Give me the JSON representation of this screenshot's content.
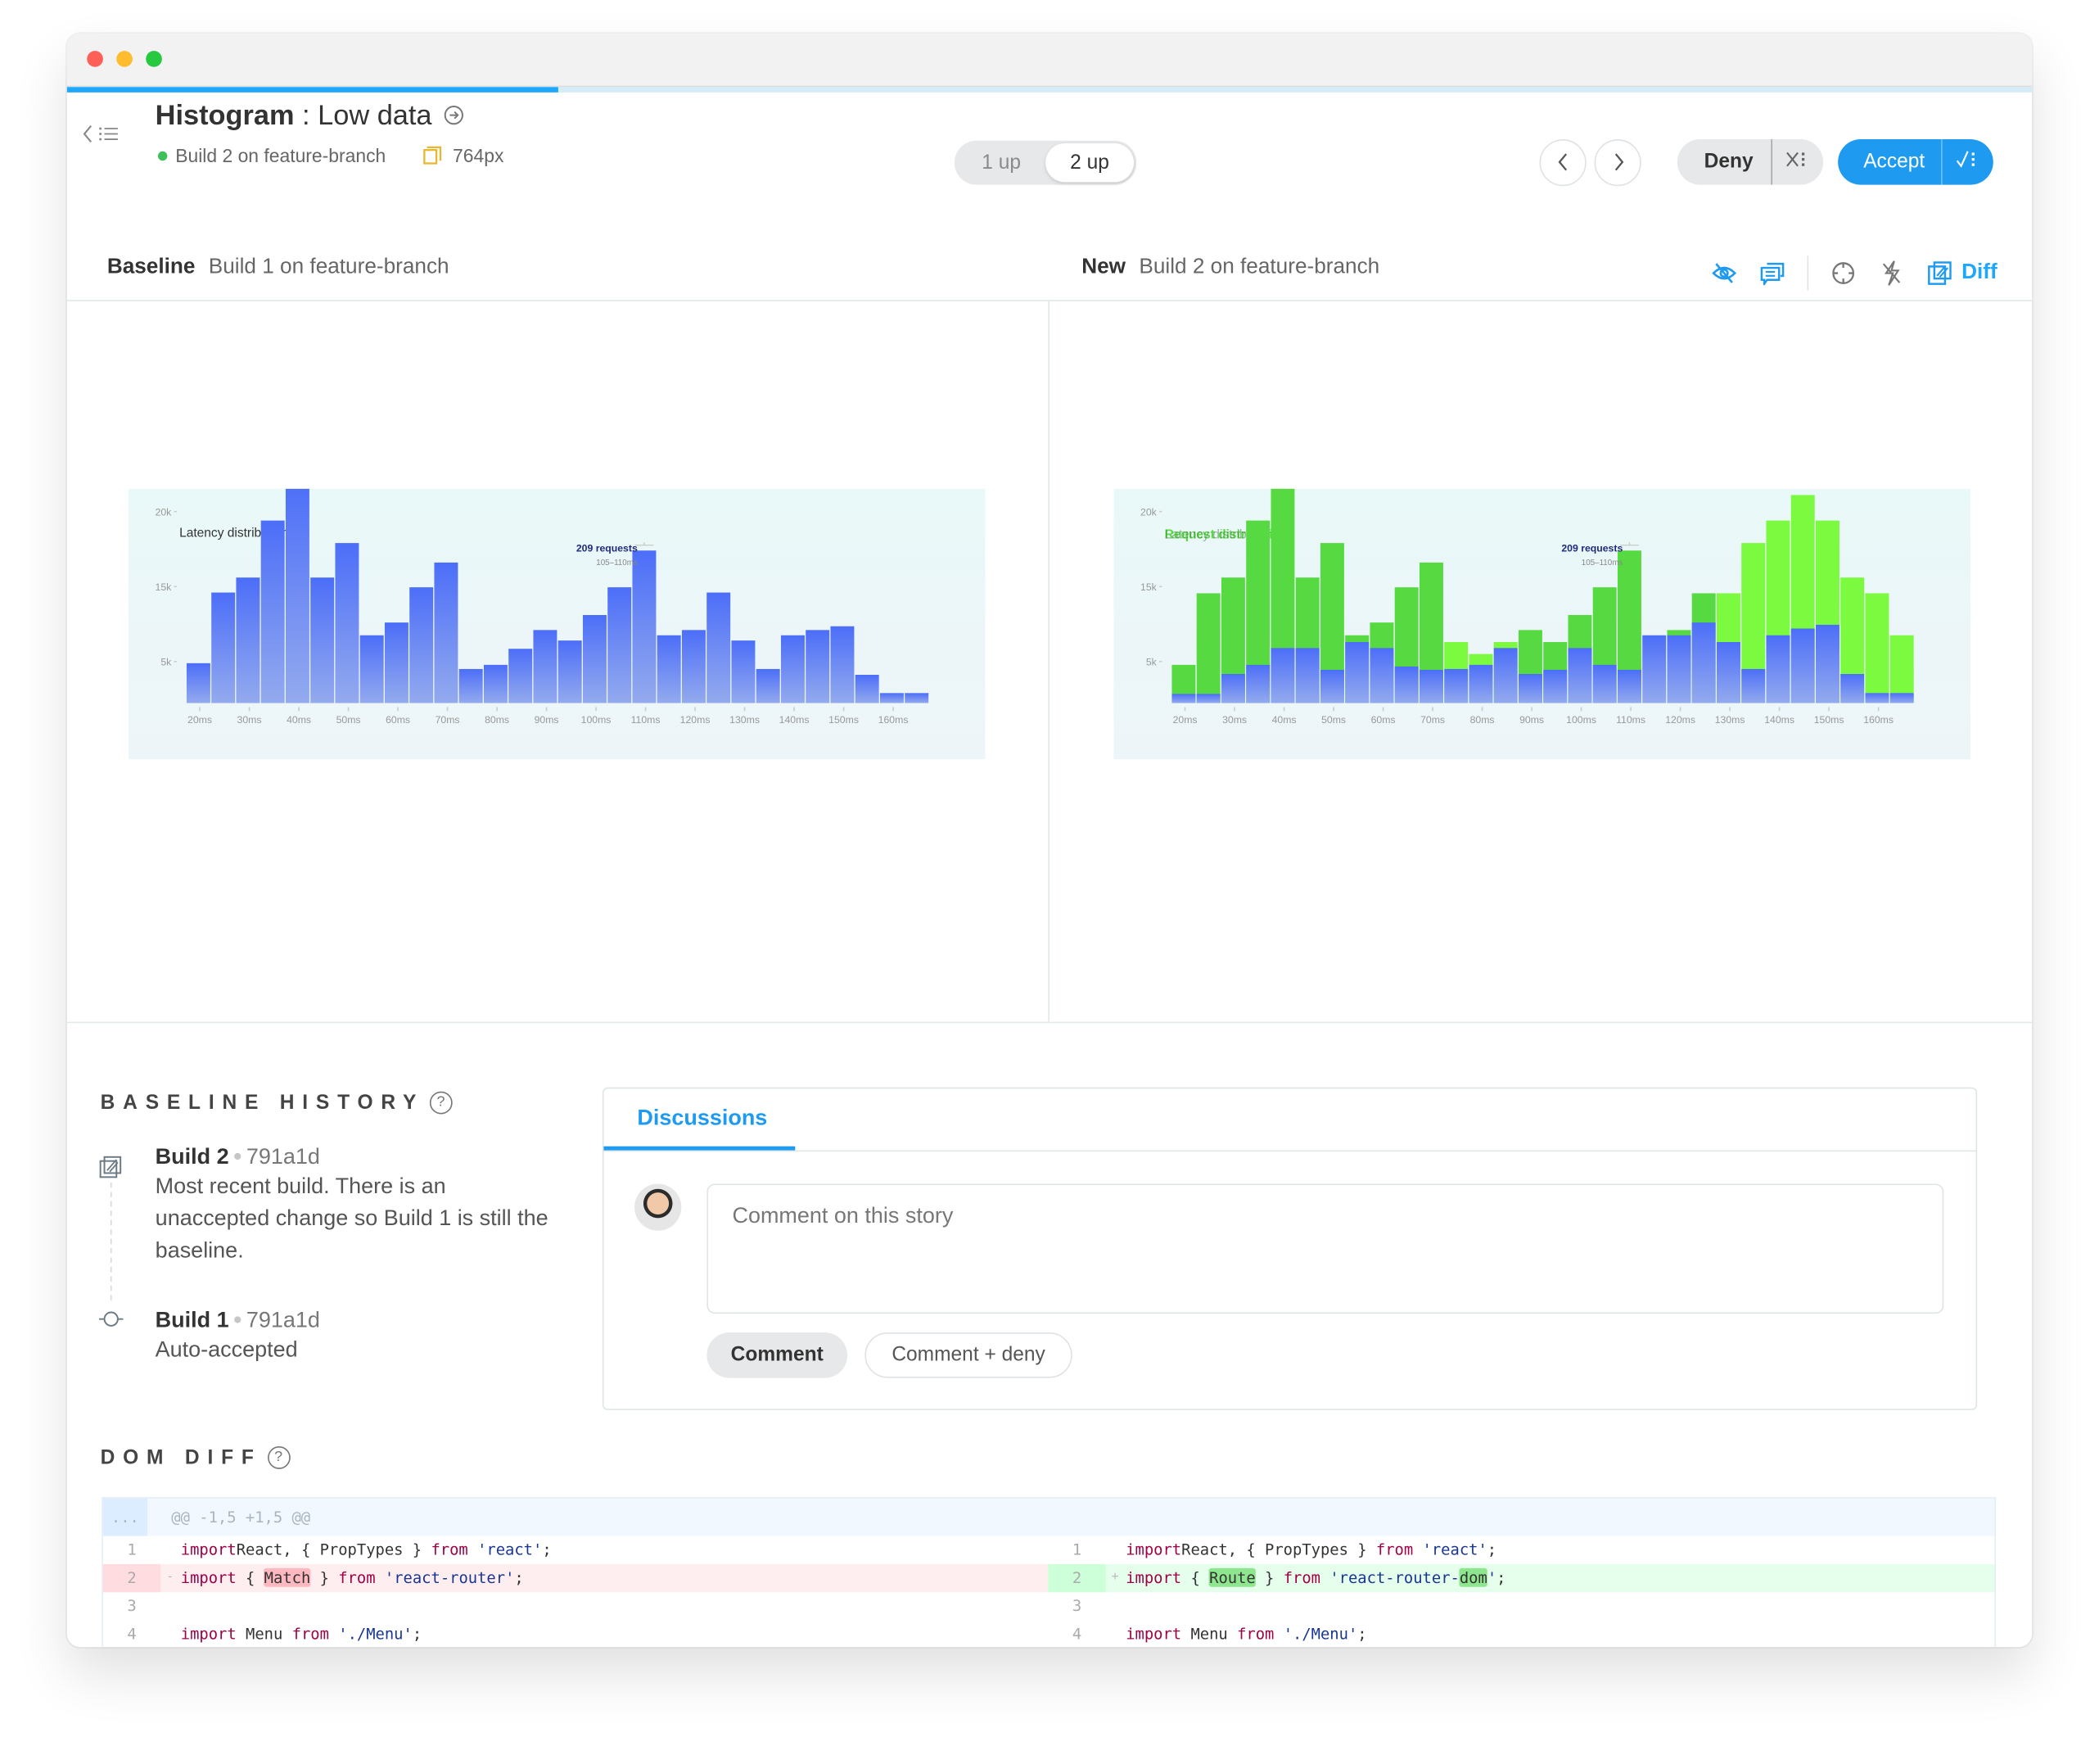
{
  "window": {
    "traffic_lights": [
      {
        "name": "close",
        "color": "#fe5f57"
      },
      {
        "name": "minimize",
        "color": "#febc2e"
      },
      {
        "name": "maximize",
        "color": "#28c840"
      }
    ],
    "progress_percent": 25,
    "progress_color": "#1ea7fd"
  },
  "header": {
    "nav_icon": "chevron-left-list-icon",
    "component": "Histogram",
    "separator": " : ",
    "story": "Low data",
    "story_link_icon": "arrow-circle-right-icon",
    "build_status_text": "Build 2 on feature-branch",
    "viewport_icon": "viewport-icon",
    "viewport": "764px",
    "view_toggle": {
      "options": [
        "1 up",
        "2 up"
      ],
      "selected": "2 up"
    },
    "prev_label": "‹",
    "next_label": "›",
    "deny_label": "Deny",
    "deny_menu_icon": "x-list-icon",
    "accept_label": "Accept",
    "accept_menu_icon": "check-list-icon",
    "accent_color": "#1e9bf0"
  },
  "compare": {
    "baseline_label": "Baseline",
    "baseline_build": "Build 1 on feature-branch",
    "new_label": "New",
    "new_build": "Build 2 on feature-branch",
    "tools": [
      "eye-off-icon",
      "comments-icon",
      "crosshair-icon",
      "lightning-off-icon",
      "diff-icon"
    ],
    "diff_label": "Diff"
  },
  "chart_data": [
    {
      "type": "bar",
      "panel": "baseline",
      "title": "Latency distribution",
      "tooltip": {
        "title": "209 requests",
        "subtitle": "105–110ms",
        "bin_index": 18
      },
      "xlabel": "",
      "ylabel": "",
      "x_tick_labels": [
        "20ms",
        "30ms",
        "40ms",
        "50ms",
        "60ms",
        "70ms",
        "80ms",
        "90ms",
        "100ms",
        "110ms",
        "120ms",
        "130ms",
        "140ms",
        "150ms",
        "160ms"
      ],
      "y_tick_labels": [
        "5k",
        "15k",
        "20k"
      ],
      "bins_ms": [
        15,
        20,
        25,
        30,
        35,
        40,
        45,
        50,
        55,
        60,
        65,
        70,
        75,
        80,
        85,
        90,
        95,
        100,
        105,
        110,
        115,
        120,
        125,
        130,
        135,
        140,
        145,
        150,
        155,
        160
      ],
      "values_k": [
        4.8,
        14.2,
        15.6,
        19.4,
        22.2,
        15.6,
        17.9,
        8.5,
        10.2,
        14.9,
        16.6,
        4.1,
        4.6,
        6.7,
        9.2,
        7.8,
        11.2,
        14.9,
        17.4,
        8.5,
        9.2,
        14.2,
        7.8,
        4.1,
        8.5,
        9.2,
        9.7,
        3.4,
        1.2,
        1.2
      ],
      "bar_color_top": "#4c6ef8",
      "bar_color_bottom": "#93aaee"
    },
    {
      "type": "bar",
      "panel": "new-diff-overlay",
      "title": "Request distribution",
      "title_overlay": "Latency distribution",
      "tooltip": {
        "title": "209 requests",
        "subtitle": "105–110ms",
        "bin_index": 18
      },
      "xlabel": "",
      "ylabel": "",
      "x_tick_labels": [
        "20ms",
        "30ms",
        "40ms",
        "50ms",
        "60ms",
        "70ms",
        "80ms",
        "90ms",
        "100ms",
        "110ms",
        "120ms",
        "130ms",
        "140ms",
        "150ms",
        "160ms"
      ],
      "y_tick_labels": [
        "5k",
        "15k",
        "20k"
      ],
      "bins_ms": [
        15,
        20,
        25,
        30,
        35,
        40,
        45,
        50,
        55,
        60,
        65,
        70,
        75,
        80,
        85,
        90,
        95,
        100,
        105,
        110,
        115,
        120,
        125,
        130,
        135,
        140,
        145,
        150,
        155,
        160
      ],
      "series": [
        {
          "name": "new",
          "values_k": [
            1.1,
            1.1,
            3.5,
            4.6,
            6.8,
            6.8,
            4.0,
            7.6,
            6.8,
            4.4,
            4.0,
            4.1,
            4.6,
            6.8,
            3.5,
            4.0,
            6.8,
            4.6,
            4.0,
            8.5,
            8.5,
            10.2,
            7.6,
            4.1,
            8.5,
            9.4,
            9.9,
            3.5,
            1.2,
            1.2
          ]
        },
        {
          "name": "diff-outline",
          "values_k": [
            4.6,
            14.1,
            15.6,
            19.4,
            22.2,
            15.6,
            17.9,
            8.5,
            10.2,
            14.9,
            16.6,
            7.6,
            6.0,
            7.6,
            9.2,
            7.6,
            11.2,
            14.9,
            17.4,
            8.5,
            9.2,
            14.1,
            14.1,
            17.9,
            19.4,
            21.1,
            19.4,
            15.6,
            14.1,
            8.5
          ]
        },
        {
          "name": "diff-kind",
          "values": [
            "removed",
            "removed",
            "removed",
            "removed",
            "removed",
            "removed",
            "removed",
            "removed",
            "removed",
            "removed",
            "removed",
            "added",
            "added",
            "added",
            "removed",
            "removed",
            "removed",
            "removed",
            "removed",
            "none",
            "removed",
            "removed",
            "added",
            "added",
            "added",
            "added",
            "added",
            "added",
            "added",
            "added"
          ]
        }
      ],
      "diff_colors": {
        "removed": "#57d941",
        "added": "#7bfa3f"
      }
    }
  ],
  "baseline_history": {
    "title": "BASELINE HISTORY",
    "help_icon": "question-circle-icon",
    "builds": [
      {
        "name": "Build 2",
        "sha": "791a1d",
        "icon": "diff-icon",
        "description": "Most recent build. There is an unaccepted change so Build 1 is still the baseline."
      },
      {
        "name": "Build 1",
        "sha": "791a1d",
        "icon": "commit-icon",
        "description": "Auto-accepted"
      }
    ]
  },
  "discussions": {
    "tab_label": "Discussions",
    "comment_placeholder": "Comment on this story",
    "comment_value": "",
    "comment_button": "Comment",
    "comment_deny_button": "Comment + deny"
  },
  "dom_diff": {
    "title": "DOM DIFF",
    "hunk_dots": "...",
    "hunk_header": "@@ -1,5 +1,5 @@",
    "left": [
      {
        "n": "1",
        "mark": "",
        "type": "ctx",
        "parts": [
          [
            "kw",
            "import"
          ],
          [
            "",
            "React, { PropTypes } "
          ],
          [
            "kw",
            "from"
          ],
          [
            "",
            ""
          ],
          [
            "str",
            " 'react'"
          ],
          [
            "",
            ";"
          ]
        ]
      },
      {
        "n": "2",
        "mark": "-",
        "type": "del",
        "parts": [
          [
            "kw",
            "import"
          ],
          [
            "",
            " { "
          ],
          [
            "hl-del",
            "Match"
          ],
          [
            "",
            " } "
          ],
          [
            "kw",
            "from"
          ],
          [
            "str",
            " 'react-router'"
          ],
          [
            "",
            ";"
          ]
        ]
      },
      {
        "n": "3",
        "mark": "",
        "type": "ctx",
        "parts": []
      },
      {
        "n": "4",
        "mark": "",
        "type": "ctx",
        "parts": [
          [
            "kw",
            "import"
          ],
          [
            "",
            " Menu "
          ],
          [
            "kw",
            "from"
          ],
          [
            "str",
            " './Menu'"
          ],
          [
            "",
            ";"
          ]
        ]
      }
    ],
    "right": [
      {
        "n": "1",
        "mark": "",
        "type": "ctx",
        "parts": [
          [
            "kw",
            "import"
          ],
          [
            "",
            "React, { PropTypes } "
          ],
          [
            "kw",
            "from"
          ],
          [
            "",
            ""
          ],
          [
            "str",
            " 'react'"
          ],
          [
            "",
            ";"
          ]
        ]
      },
      {
        "n": "2",
        "mark": "+",
        "type": "add",
        "parts": [
          [
            "kw",
            "import"
          ],
          [
            "",
            " { "
          ],
          [
            "hl-add",
            "Route"
          ],
          [
            "",
            " } "
          ],
          [
            "kw",
            "from"
          ],
          [
            "str",
            " 'react-router-"
          ],
          [
            "hl-add",
            "dom"
          ],
          [
            "str",
            "'"
          ],
          [
            "",
            ";"
          ]
        ]
      },
      {
        "n": "3",
        "mark": "",
        "type": "ctx",
        "parts": []
      },
      {
        "n": "4",
        "mark": "",
        "type": "ctx",
        "parts": [
          [
            "kw",
            "import"
          ],
          [
            "",
            " Menu "
          ],
          [
            "kw",
            "from"
          ],
          [
            "str",
            " './Menu'"
          ],
          [
            "",
            ";"
          ]
        ]
      }
    ]
  }
}
